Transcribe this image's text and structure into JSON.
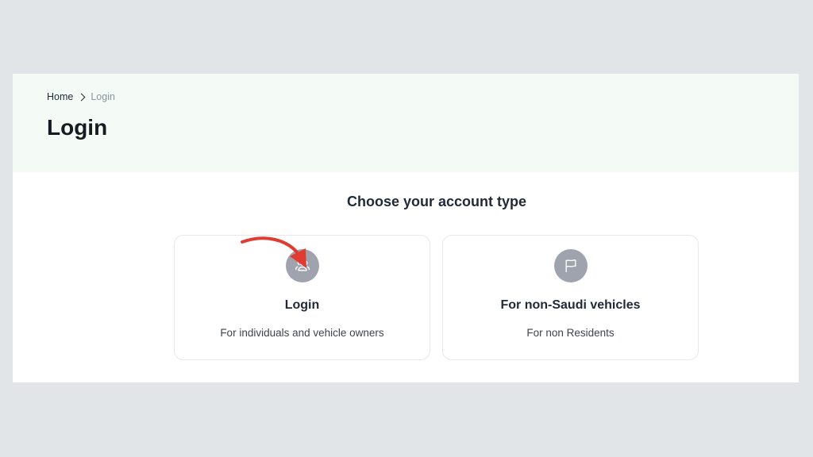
{
  "breadcrumb": {
    "home": "Home",
    "current": "Login"
  },
  "page_title": "Login",
  "section_title": "Choose your account type",
  "cards": [
    {
      "title": "Login",
      "description": "For individuals and vehicle owners",
      "icon": "users-icon"
    },
    {
      "title": "For non-Saudi vehicles",
      "description": "For non Residents",
      "icon": "flag-icon"
    }
  ],
  "colors": {
    "background": "#e1e5e8",
    "hero_background": "#f4fbf6",
    "icon_circle": "#9ea3ae",
    "annotation_arrow": "#e03c31"
  }
}
